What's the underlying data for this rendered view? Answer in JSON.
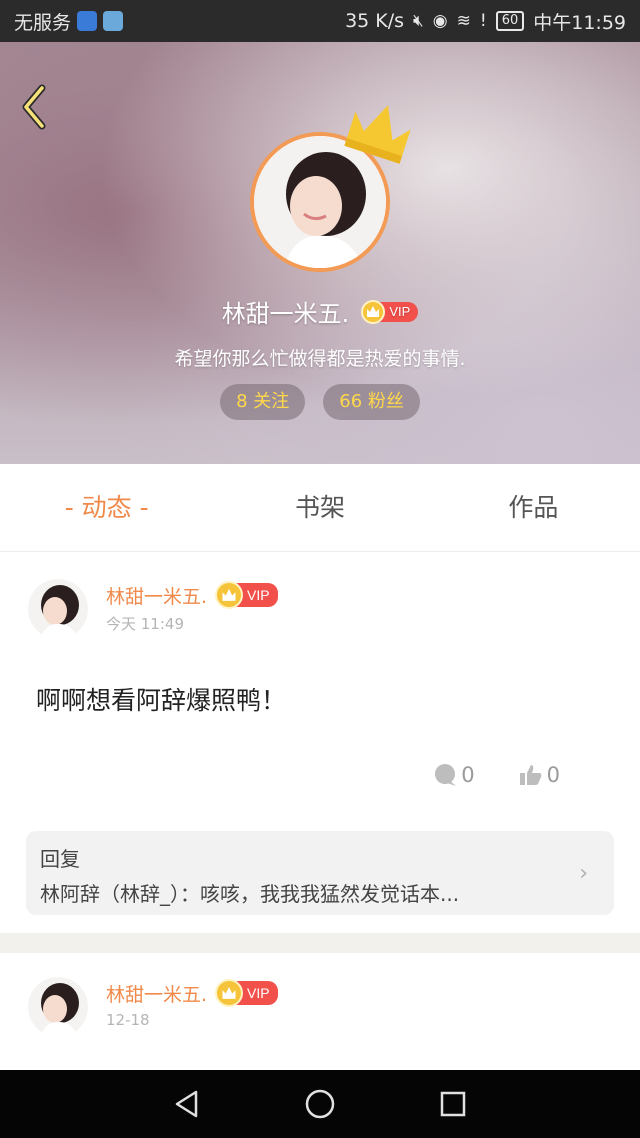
{
  "status_bar": {
    "carrier": "无服务",
    "speed": "35 K/s",
    "battery": "60",
    "time": "中午11:59"
  },
  "profile": {
    "name": "林甜一米五.",
    "vip_label": "VIP",
    "bio": "希望你那么忙做得都是热爱的事情.",
    "following": "8 关注",
    "followers": "66 粉丝"
  },
  "tabs": [
    {
      "label": "- 动态 -",
      "active": true
    },
    {
      "label": "书架",
      "active": false
    },
    {
      "label": "作品",
      "active": false
    }
  ],
  "posts": [
    {
      "author": "林甜一米五.",
      "vip_label": "VIP",
      "time": "今天 11:49",
      "text": "啊啊想看阿辞爆照鸭！",
      "comments": "0",
      "likes": "0",
      "reply_label": "回复",
      "reply_text": "林阿辞（林辞_）：咳咳，我我我猛然发觉话本..."
    },
    {
      "author": "林甜一米五.",
      "vip_label": "VIP",
      "time": "12-18"
    }
  ],
  "colors": {
    "accent": "#f08a4b",
    "vip_red": "#f2504b",
    "vip_gold": "#f6c43a",
    "stat_text": "#ffd84a"
  }
}
